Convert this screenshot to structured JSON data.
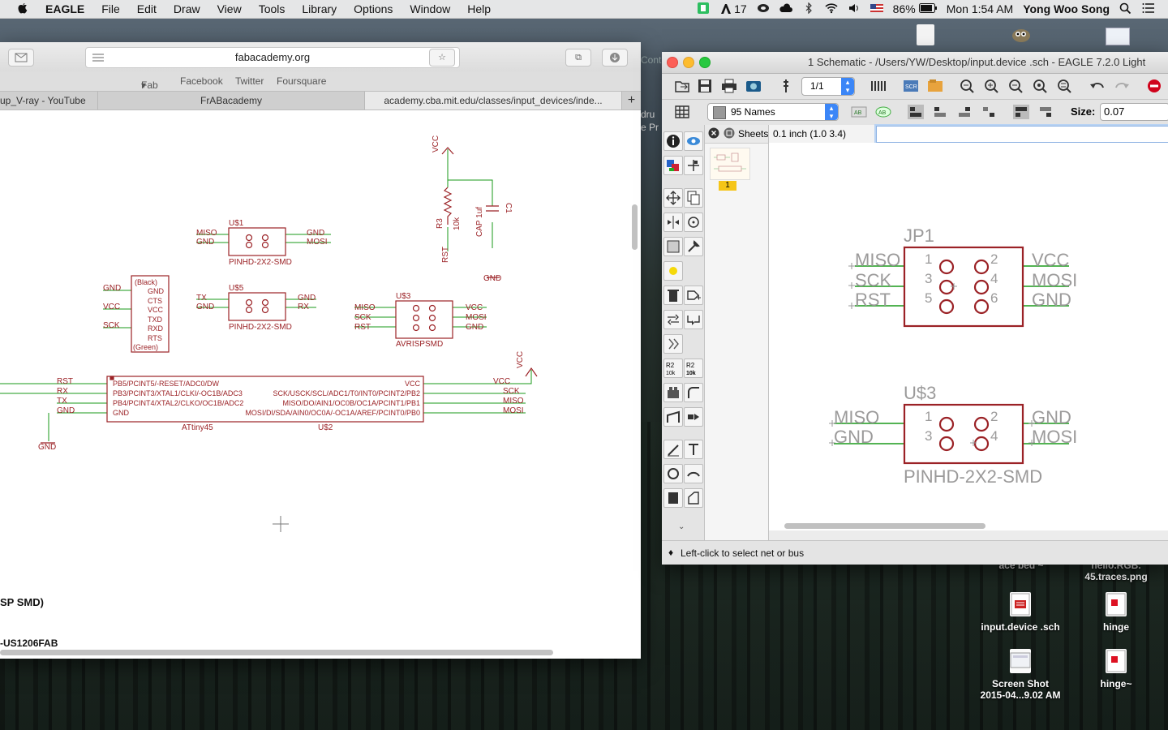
{
  "menubar": {
    "app_name": "EAGLE",
    "items": [
      "File",
      "Edit",
      "Draw",
      "View",
      "Tools",
      "Library",
      "Options",
      "Window",
      "Help"
    ],
    "status": {
      "notifications": "17",
      "battery": "86%",
      "clock": "Mon 1:54 AM",
      "user": "Yong Woo Song"
    }
  },
  "desktop": {
    "icons": [
      {
        "label_1": "ace bed ~",
        "label_2": ""
      },
      {
        "label_1": "hello.RGB.",
        "label_2": "45.traces.png"
      },
      {
        "label_1": "input.device .sch",
        "label_2": ""
      },
      {
        "label_1": "hinge",
        "label_2": ""
      },
      {
        "label_1": "Screen Shot",
        "label_2": "2015-04...9.02 AM"
      },
      {
        "label_1": "hinge~",
        "label_2": ""
      }
    ],
    "behind_window_text": [
      "Cont",
      "dru",
      "e Pr"
    ]
  },
  "browser": {
    "url": "fabacademy.org",
    "favorites": [
      "Fab",
      "Facebook",
      "Twitter",
      "Foursquare"
    ],
    "tabs": [
      {
        "label": "up_V-ray - YouTube"
      },
      {
        "label": "FrABacademy"
      },
      {
        "label": "academy.cba.mit.edu/classes/input_devices/inde..."
      }
    ],
    "new_tab": "+",
    "page_text": {
      "line_1": "SP SMD)",
      "line_2": "-US1206FAB"
    }
  },
  "schematic_image": {
    "vcc": "VCC",
    "gnd": "GND",
    "rst": "RST",
    "r3": "R3",
    "r3_val": "10k",
    "c1": "C1",
    "c1_val": "CAP 1uf",
    "u1": "U$1",
    "u5": "U$5",
    "u3": "U$3",
    "u2": "U$2",
    "pinhd": "PINHD-2X2-SMD",
    "avrisp": "AVRISPSMD",
    "attiny": "ATtiny45",
    "miso": "MISO",
    "mosi": "MOSI",
    "sck": "SCK",
    "tx": "TX",
    "rx": "RX",
    "ftdi_pins": [
      "(Black)",
      "GND",
      "CTS",
      "VCC",
      "TXD",
      "RXD",
      "RTS",
      "(Green)"
    ],
    "ftdi_labels": [
      "GND",
      "VCC",
      "SCK"
    ],
    "attiny_left": [
      "PB5/PCINT5/-RESET/ADC0/DW",
      "PB3/PCINT3/XTAL1/CLKI/-OC1B/ADC3",
      "PB4/PCINT4/XTAL2/CLKO/OC1B/ADC2",
      "GND"
    ],
    "attiny_right": [
      "VCC",
      "SCK/USCK/SCL/ADC1/T0/INT0/PCINT2/PB2",
      "MISO/DO/AIN1/OC0B/OC1A/PCINT1/PB1",
      "MOSI/DI/SDA/AIN0/OC0A/-OC1A/AREF/PCINT0/PB0"
    ]
  },
  "eagle": {
    "title": "1 Schematic - /Users/YW/Desktop/input.device .sch - EAGLE 7.2.0 Light",
    "sheet_selector": "1/1",
    "layer": "95 Names",
    "size_label": "Size:",
    "size_value": "0.07",
    "sheets_label": "Sheets",
    "sheet_number": "1",
    "grid_coord": "0.1 inch (1.0 3.4)",
    "status_hint": "Left-click to select net or bus",
    "jp1": {
      "name": "JP1",
      "left": [
        "MISO",
        "SCK",
        "RST"
      ],
      "right": [
        "VCC",
        "MOSI",
        "GND"
      ],
      "pins_l": [
        "1",
        "3",
        "5"
      ],
      "pins_r": [
        "2",
        "4",
        "6"
      ]
    },
    "u3": {
      "name": "U$3",
      "left": [
        "MISO",
        "GND"
      ],
      "right": [
        "GND",
        "MOSI"
      ],
      "pins_l": [
        "1",
        "3"
      ],
      "pins_r": [
        "2",
        "4"
      ],
      "value": "PINHD-2X2-SMD"
    }
  },
  "colors": {
    "net": "#1a9a1a",
    "part": "#9b2226",
    "eagle_stop": "#d0021b"
  }
}
